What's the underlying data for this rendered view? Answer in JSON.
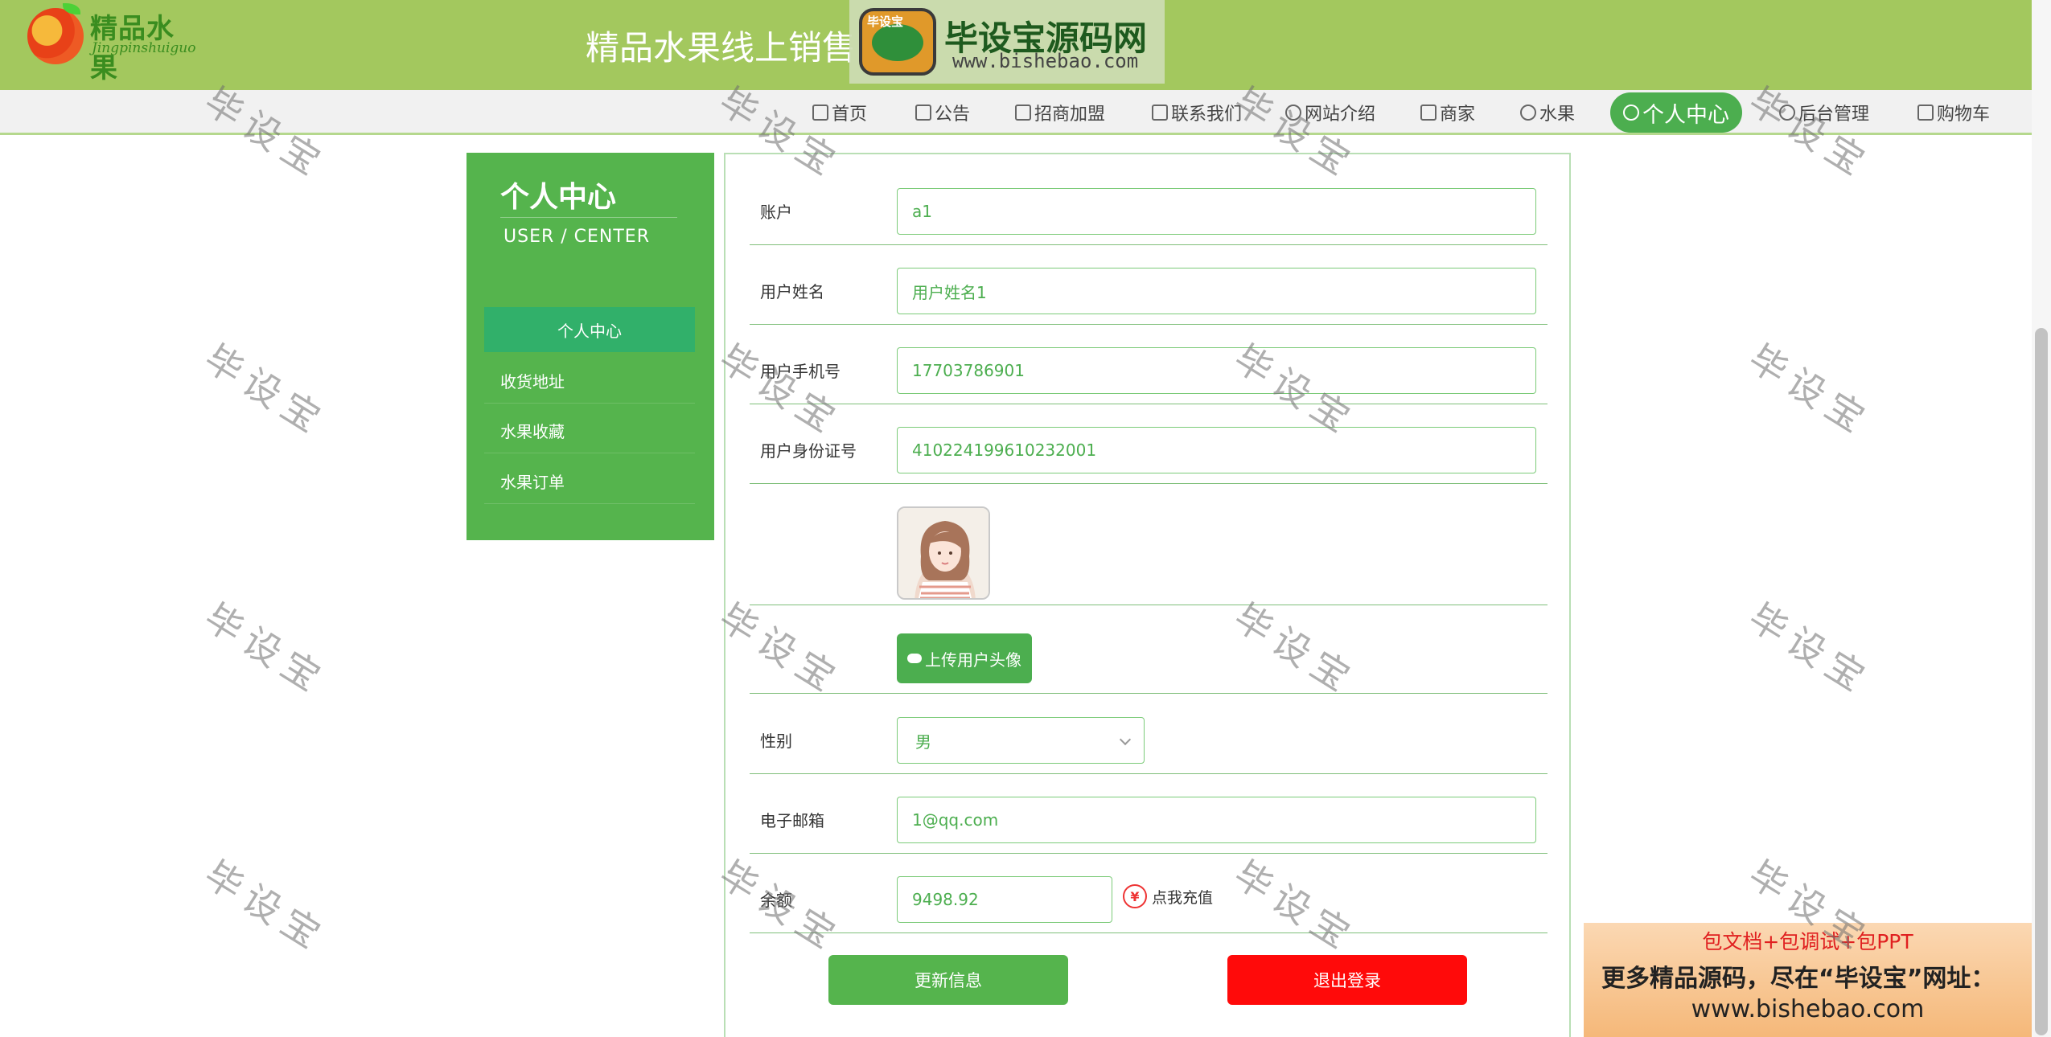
{
  "header": {
    "logo_text": "精品水果",
    "logo_sub": "Jingpinshuiguo",
    "site_title": "精品水果线上销售网"
  },
  "watermark_banner": {
    "badge": "毕设宝",
    "name": "毕设宝源码网",
    "url": "www.bishebao.com"
  },
  "nav": {
    "items": [
      {
        "label": "首页",
        "icon": "home-icon"
      },
      {
        "label": "公告",
        "icon": "printer-icon"
      },
      {
        "label": "招商加盟",
        "icon": "tag-icon"
      },
      {
        "label": "联系我们",
        "icon": "building-icon"
      },
      {
        "label": "网站介绍",
        "icon": "globe-icon"
      },
      {
        "label": "商家",
        "icon": "grid-icon"
      },
      {
        "label": "水果",
        "icon": "circle-icon"
      },
      {
        "label": "个人中心",
        "icon": "user-icon"
      },
      {
        "label": "后台管理",
        "icon": "link-icon"
      },
      {
        "label": "购物车",
        "icon": "cart-icon"
      }
    ],
    "active": "个人中心"
  },
  "sidebar": {
    "title": "个人中心",
    "subtitle": "USER / CENTER",
    "items": [
      {
        "label": "个人中心"
      },
      {
        "label": "收货地址"
      },
      {
        "label": "水果收藏"
      },
      {
        "label": "水果订单"
      }
    ]
  },
  "form": {
    "account": {
      "label": "账户",
      "value": "a1"
    },
    "name": {
      "label": "用户姓名",
      "value": "用户姓名1"
    },
    "phone": {
      "label": "用户手机号",
      "value": "17703786901"
    },
    "id_number": {
      "label": "用户身份证号",
      "value": "410224199610232001"
    },
    "upload_label": "上传用户头像",
    "gender": {
      "label": "性别",
      "value": "男"
    },
    "email": {
      "label": "电子邮箱",
      "value": "1@qq.com"
    },
    "balance": {
      "label": "余额",
      "value": "9498.92"
    },
    "recharge_label": "点我充值",
    "recharge_icon": "¥",
    "update_button": "更新信息",
    "logout_button": "退出登录"
  },
  "promo": {
    "line1": "包文档+包调试+包PPT",
    "line2": "更多精品源码，尽在“毕设宝”网址：",
    "line3": "www.bishebao.com"
  },
  "watermark_text": "毕设宝",
  "colors": {
    "header_green": "#a3c85e",
    "primary_green": "#55b44d",
    "active_menu": "#31b06a",
    "logout_red": "#ff0a0a"
  }
}
